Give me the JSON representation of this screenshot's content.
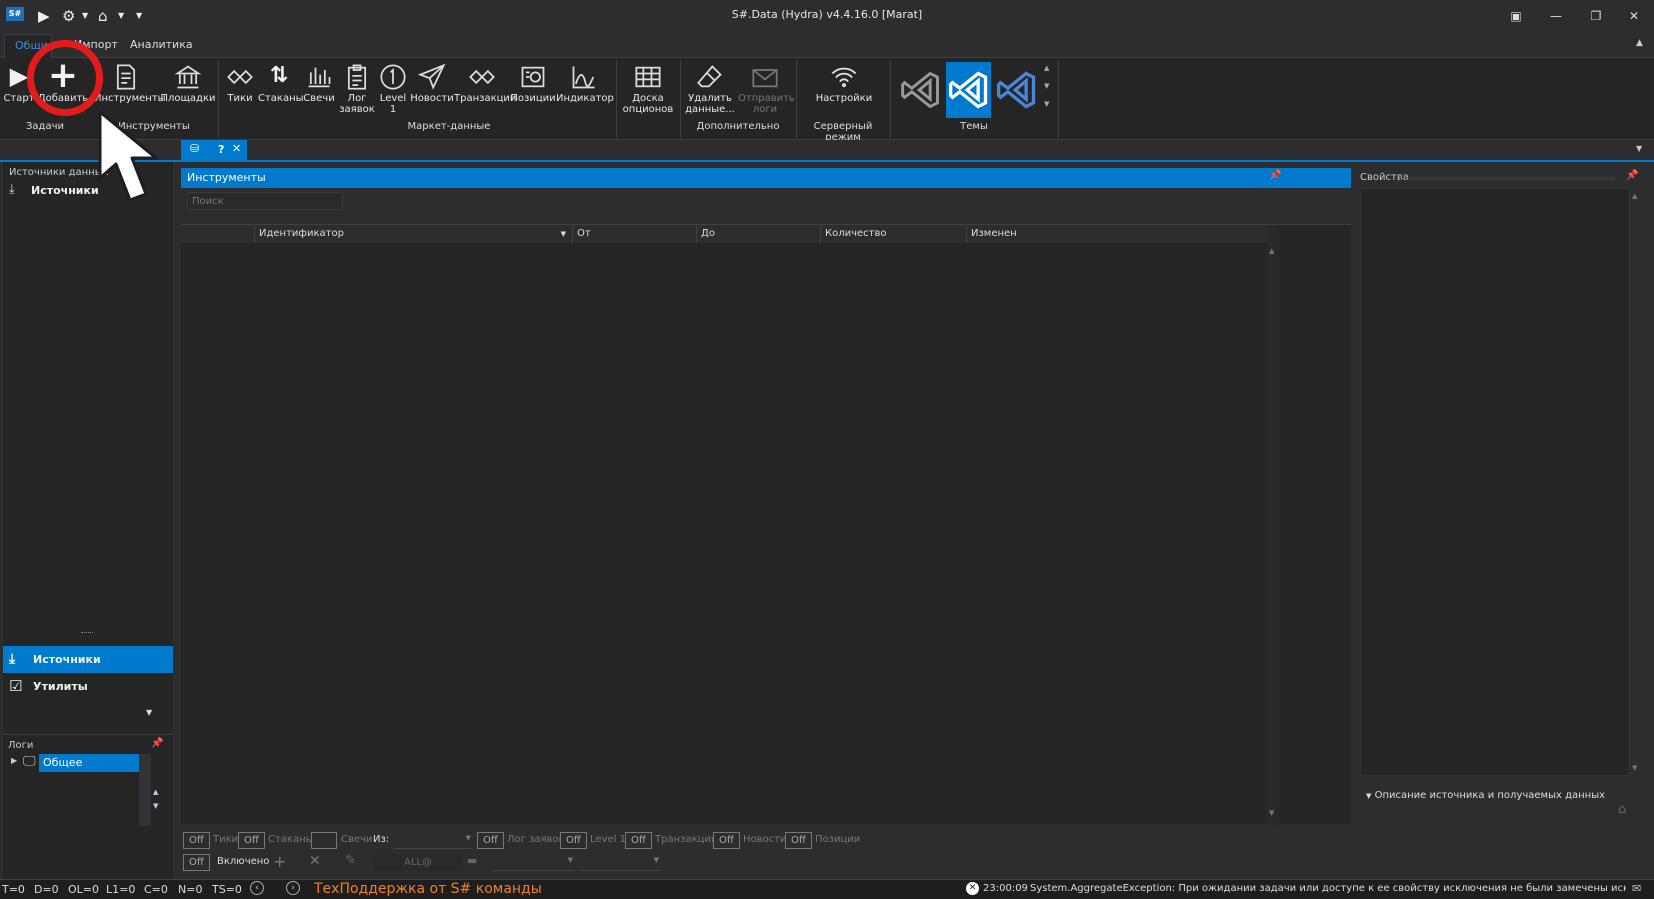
{
  "window": {
    "title": "S#.Data (Hydra) v4.4.16.0 [Marat]",
    "logo": "S#"
  },
  "ribbon_tabs": [
    "Общие",
    "Импорт",
    "Аналитика"
  ],
  "ribbon": {
    "start": "Старт",
    "add": "Добавить",
    "instruments": "Инструменты",
    "venues": "Площадки",
    "ticks": "Тики",
    "books": "Стаканы",
    "candles": "Свечи",
    "orderlog": "Лог заявок",
    "level1": "Level 1",
    "news": "Новости",
    "transactions": "Транзакции",
    "positions": "Позиции",
    "indicator": "Индикатор",
    "options": "Доска опционов",
    "delete": "Удалить данные...",
    "sendlogs": "Отправить логи",
    "settings": "Настройки",
    "groups": {
      "tasks": "Задачи",
      "instruments": "Инструменты",
      "market": "Маркет-данные",
      "extra": "Дополнительно",
      "server": "Серверный режим",
      "themes": "Темы"
    }
  },
  "left": {
    "sources_title": "Источники данных",
    "sources_item": "Источники",
    "nav_sources": "Источники",
    "nav_utils": "Утилиты",
    "logs_title": "Логи",
    "logs_item": "Общее"
  },
  "main": {
    "panel_title": "Инструменты",
    "search_placeholder": "Поиск",
    "columns": [
      "Идентификатор",
      "От",
      "До",
      "Количество",
      "Изменен"
    ],
    "toolbar": {
      "off": "Off",
      "ticks": "Тики",
      "books": "Стаканы",
      "candles": "Свечи",
      "from": "Из:",
      "orderlog": "Лог заявок",
      "level1": "Level 1",
      "transactions": "Транзакции",
      "news": "Новости",
      "positions": "Позиции",
      "enabled": "Включено",
      "all": "ALL@"
    }
  },
  "props": {
    "title": "Свойства",
    "desc": "Описание источника и получаемых данных"
  },
  "status": {
    "t": "T=0",
    "d": "D=0",
    "ol": "OL=0",
    "l1": "L1=0",
    "c": "C=0",
    "n": "N=0",
    "ts": "TS=0",
    "support": "ТехПоддержка от S# команды",
    "time": "23:00:09",
    "error": "System.AggregateException: При ожидании задачи или доступе к ее свойству исключения не были замечены исключения зад"
  },
  "colors": {
    "accent": "#007acc",
    "support": "#f0821e",
    "highlight": "#e41b1b"
  }
}
